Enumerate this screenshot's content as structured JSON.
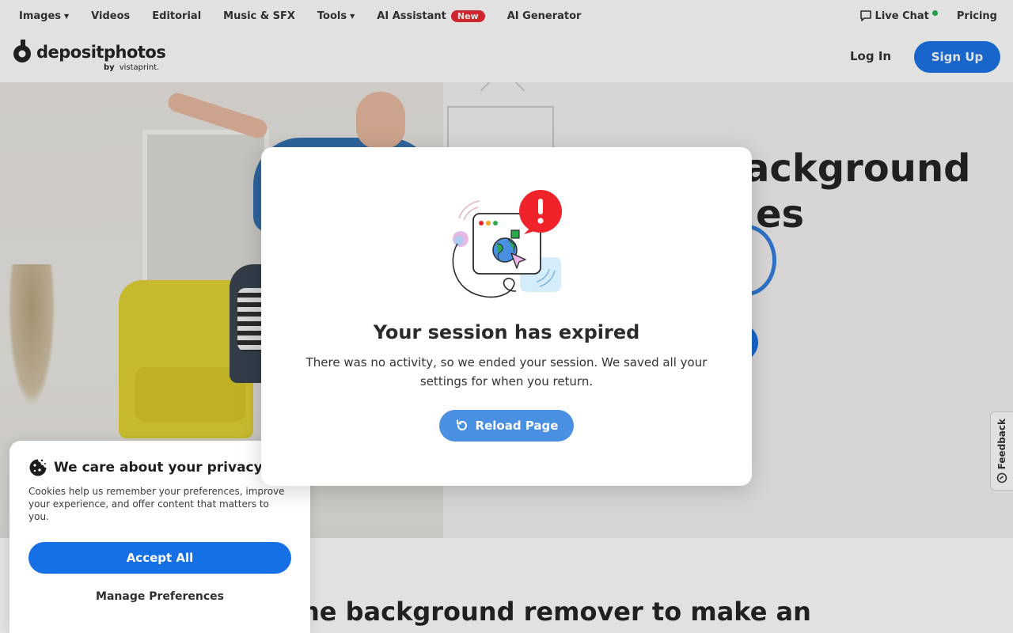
{
  "topnav": {
    "items": [
      {
        "label": "Images",
        "dropdown": true
      },
      {
        "label": "Videos",
        "dropdown": false
      },
      {
        "label": "Editorial",
        "dropdown": false
      },
      {
        "label": "Music & SFX",
        "dropdown": false
      },
      {
        "label": "Tools",
        "dropdown": true
      },
      {
        "label": "AI Assistant",
        "dropdown": false,
        "badge": "New"
      },
      {
        "label": "AI Generator",
        "dropdown": false
      }
    ],
    "live_chat": "Live Chat",
    "pricing": "Pricing"
  },
  "header": {
    "logo_word": "depositphotos",
    "logo_by": "by",
    "logo_partner": "vistaprint.",
    "login": "Log In",
    "signup": "Sign Up"
  },
  "hero": {
    "title_fragment_1": "ackground",
    "title_fragment_2": "es"
  },
  "bottom_heading": "ine background remover to make an",
  "feedback": {
    "label": "Feedback"
  },
  "privacy": {
    "title": "We care about your privacy",
    "text": "Cookies help us remember your preferences, improve your experience, and offer content that matters to you.",
    "accept": "Accept All",
    "manage": "Manage Preferences"
  },
  "modal": {
    "title": "Your session has expired",
    "text": "There was no activity, so we ended your session. We saved all your settings for when you return.",
    "button": "Reload Page"
  },
  "colors": {
    "brand_blue": "#1570e6",
    "reload_blue": "#4a90e2",
    "alert_red": "#f0232a",
    "badge_red": "#e8262f",
    "online_green": "#22b14c"
  },
  "icons": [
    "chat-bubble-icon",
    "reload-icon",
    "cookie-icon",
    "feedback-icon",
    "session-expired-illustration",
    "caret-down-icon"
  ]
}
